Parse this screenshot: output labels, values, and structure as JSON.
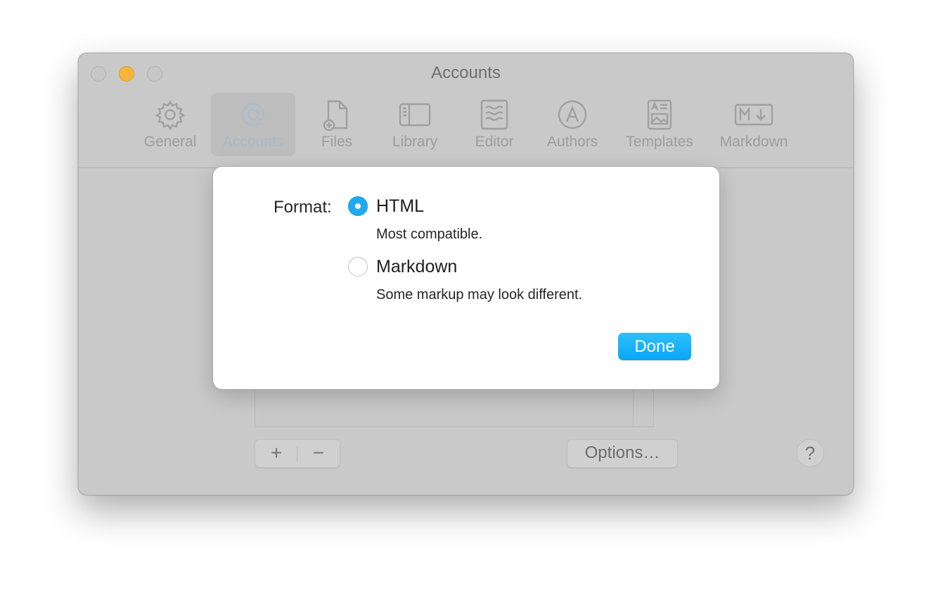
{
  "window": {
    "title": "Accounts"
  },
  "toolbar": {
    "items": [
      {
        "label": "General",
        "icon": "gear-icon"
      },
      {
        "label": "Accounts",
        "icon": "at-sign-icon",
        "selected": true
      },
      {
        "label": "Files",
        "icon": "file-add-icon"
      },
      {
        "label": "Library",
        "icon": "sidebar-icon"
      },
      {
        "label": "Editor",
        "icon": "text-editor-icon"
      },
      {
        "label": "Authors",
        "icon": "author-circle-icon"
      },
      {
        "label": "Templates",
        "icon": "template-icon"
      },
      {
        "label": "Markdown",
        "icon": "markdown-icon"
      }
    ]
  },
  "controls": {
    "add_label": "+",
    "remove_label": "−",
    "options_label": "Options…",
    "help_label": "?"
  },
  "sheet": {
    "format_label": "Format:",
    "options": [
      {
        "label": "HTML",
        "description": "Most compatible.",
        "selected": true
      },
      {
        "label": "Markdown",
        "description": "Some markup may look different.",
        "selected": false
      }
    ],
    "done_label": "Done",
    "accent_color": "#1faaf2"
  }
}
